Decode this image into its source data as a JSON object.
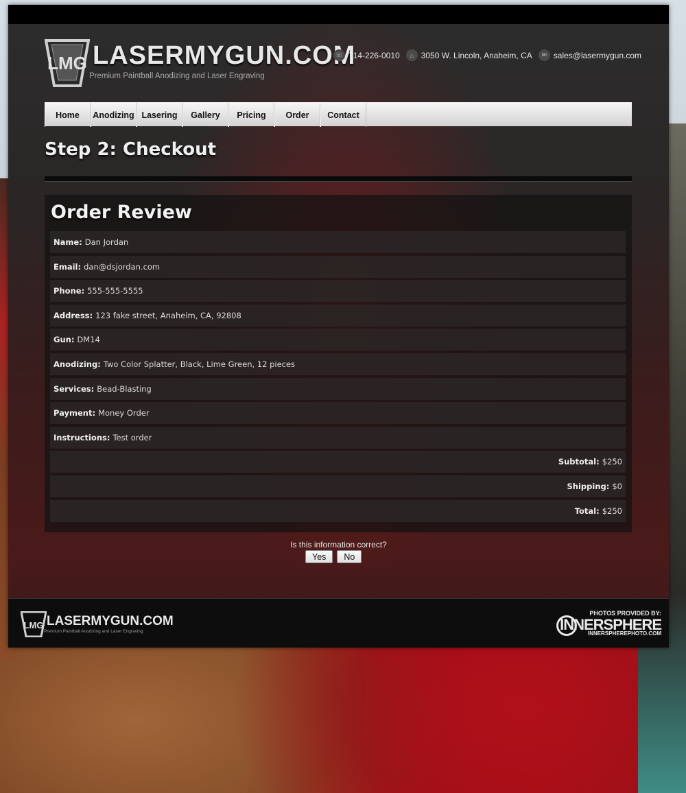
{
  "header": {
    "logo_text": "LASERMYGUN.COM",
    "tagline": "Premium Paintball Anodizing and Laser Engraving",
    "phone": "714-226-0010",
    "address": "3050 W. Lincoln, Anaheim, CA",
    "email": "sales@lasermygun.com"
  },
  "nav": {
    "items": [
      "Home",
      "Anodizing",
      "Lasering",
      "Gallery",
      "Pricing",
      "Order",
      "Contact"
    ]
  },
  "page": {
    "title": "Step 2: Checkout"
  },
  "order_review": {
    "title": "Order Review",
    "fields": [
      {
        "label": "Name:",
        "value": "Dan Jordan"
      },
      {
        "label": "Email:",
        "value": "dan@dsjordan.com"
      },
      {
        "label": "Phone:",
        "value": "555-555-5555"
      },
      {
        "label": "Address:",
        "value": "123 fake street, Anaheim, CA, 92808"
      },
      {
        "label": "Gun:",
        "value": "DM14"
      },
      {
        "label": "Anodizing:",
        "value": "Two Color Splatter, Black, Lime Green, 12 pieces"
      },
      {
        "label": "Services:",
        "value": "Bead-Blasting"
      },
      {
        "label": "Payment:",
        "value": "Money Order"
      },
      {
        "label": "Instructions:",
        "value": "Test order"
      }
    ],
    "totals": [
      {
        "label": "Subtotal:",
        "value": "$250"
      },
      {
        "label": "Shipping:",
        "value": "$0"
      },
      {
        "label": "Total:",
        "value": "$250"
      }
    ]
  },
  "confirm": {
    "question": "Is this information correct?",
    "yes_label": "Yes",
    "no_label": "No"
  },
  "footer": {
    "logo_text": "LASERMYGUN.COM",
    "tagline": "Premium Paintball Anodizing and Laser Engraving",
    "photos_label": "PHOTOS PROVIDED BY:",
    "photographer": "INNERSPHERE",
    "photographer_url": "INNERSPHEREPHOTO.COM"
  }
}
